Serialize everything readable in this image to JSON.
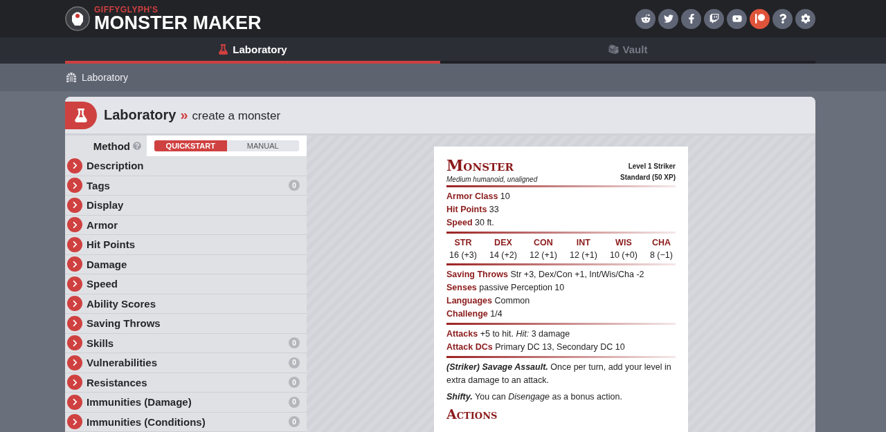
{
  "header": {
    "brand_small": "GIFFYGLYPH'S",
    "brand_title": "MONSTER MAKER",
    "social": [
      {
        "kind": "reddit"
      },
      {
        "kind": "twitter"
      },
      {
        "kind": "facebook"
      },
      {
        "kind": "twitch"
      },
      {
        "kind": "youtube"
      },
      {
        "kind": "patreon"
      },
      {
        "kind": "help"
      },
      {
        "kind": "settings"
      }
    ]
  },
  "tabs": [
    {
      "label": "Laboratory",
      "kind": "flask",
      "selected": true
    },
    {
      "label": "Vault",
      "kind": "vault",
      "selected": false
    }
  ],
  "breadcrumb": "Laboratory",
  "page": {
    "title": "Laboratory",
    "separator": "»",
    "subtitle": "create a monster"
  },
  "method": {
    "label": "Method",
    "options": [
      {
        "label": "QUICKSTART",
        "selected": true
      },
      {
        "label": "MANUAL",
        "selected": false
      }
    ]
  },
  "sections": [
    {
      "label": "Description"
    },
    {
      "label": "Tags",
      "count": "0"
    },
    {
      "label": "Display"
    },
    {
      "label": "Armor"
    },
    {
      "label": "Hit Points"
    },
    {
      "label": "Damage"
    },
    {
      "label": "Speed"
    },
    {
      "label": "Ability Scores"
    },
    {
      "label": "Saving Throws"
    },
    {
      "label": "Skills",
      "count": "0"
    },
    {
      "label": "Vulnerabilities",
      "count": "0"
    },
    {
      "label": "Resistances",
      "count": "0"
    },
    {
      "label": "Immunities (Damage)",
      "count": "0"
    },
    {
      "label": "Immunities (Conditions)",
      "count": "0"
    }
  ],
  "statblock": {
    "name": "Monster",
    "type": "Medium humanoid, unaligned",
    "role": "Level 1 Striker",
    "xp": "Standard (50 XP)",
    "basics": [
      {
        "label": "Armor Class",
        "value": "10"
      },
      {
        "label": "Hit Points",
        "value": "33"
      },
      {
        "label": "Speed",
        "value": "30 ft."
      }
    ],
    "abilities": [
      {
        "name": "STR",
        "score": "16 (+3)"
      },
      {
        "name": "DEX",
        "score": "14 (+2)"
      },
      {
        "name": "CON",
        "score": "12 (+1)"
      },
      {
        "name": "INT",
        "score": "12 (+1)"
      },
      {
        "name": "WIS",
        "score": "10 (+0)"
      },
      {
        "name": "CHA",
        "score": "8 (−1)"
      }
    ],
    "details": [
      {
        "label": "Saving Throws",
        "value": "Str +3, Dex/Con +1, Int/Wis/Cha -2"
      },
      {
        "label": "Senses",
        "value": "passive Perception 10"
      },
      {
        "label": "Languages",
        "value": "Common"
      },
      {
        "label": "Challenge",
        "value": "1/4"
      }
    ],
    "attacks": [
      {
        "label": "Attacks",
        "value": "+5 to hit. *Hit:* 3 damage"
      },
      {
        "label": "Attack DCs",
        "value": "Primary DC 13, Secondary DC 10"
      }
    ],
    "features": [
      {
        "name": "(Striker) Savage Assault.",
        "text": "Once per turn, add your level in extra damage to an attack."
      },
      {
        "name": "Shifty.",
        "text": "You can *Disengage* as a bonus action."
      }
    ],
    "actions_heading": "Actions"
  }
}
